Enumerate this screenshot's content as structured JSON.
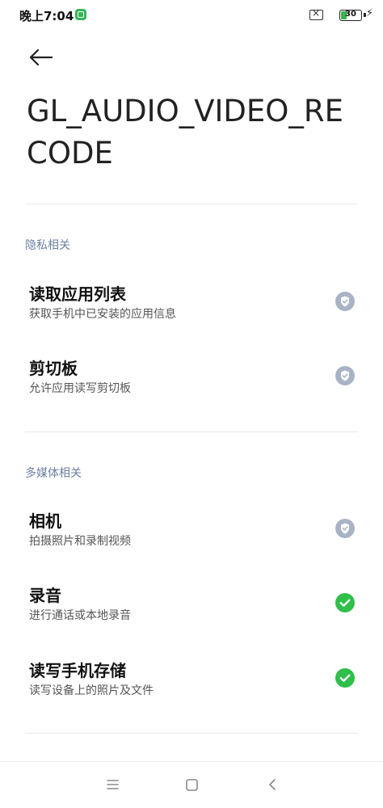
{
  "status_bar": {
    "time": "晚上7:04",
    "battery_level": "30",
    "battery_percent": 30,
    "icons": [
      "app-notification-icon",
      "sim-no-service-icon",
      "battery-icon",
      "charging-icon"
    ]
  },
  "header": {
    "back_icon": "arrow-left-icon",
    "title": "GL_AUDIO_VIDEO_RECODE"
  },
  "sections": [
    {
      "header": "隐私相关",
      "items": [
        {
          "title": "读取应用列表",
          "desc": "获取手机中已安装的应用信息",
          "status": "shield-check-gray"
        },
        {
          "title": "剪切板",
          "desc": "允许应用读写剪切板",
          "status": "shield-check-gray"
        }
      ]
    },
    {
      "header": "多媒体相关",
      "items": [
        {
          "title": "相机",
          "desc": "拍摄照片和录制视频",
          "status": "shield-check-gray"
        },
        {
          "title": "录音",
          "desc": "进行通话或本地录音",
          "status": "check-green"
        },
        {
          "title": "读写手机存储",
          "desc": "读写设备上的照片及文件",
          "status": "check-green"
        }
      ]
    }
  ],
  "colors": {
    "section_header": "#6e80a3",
    "status_gray": "#a9b3c6",
    "status_green": "#2fbf4a",
    "battery_green": "#39b54a"
  },
  "nav_bar": {
    "icons": [
      "menu-icon",
      "home-icon",
      "back-icon"
    ]
  }
}
